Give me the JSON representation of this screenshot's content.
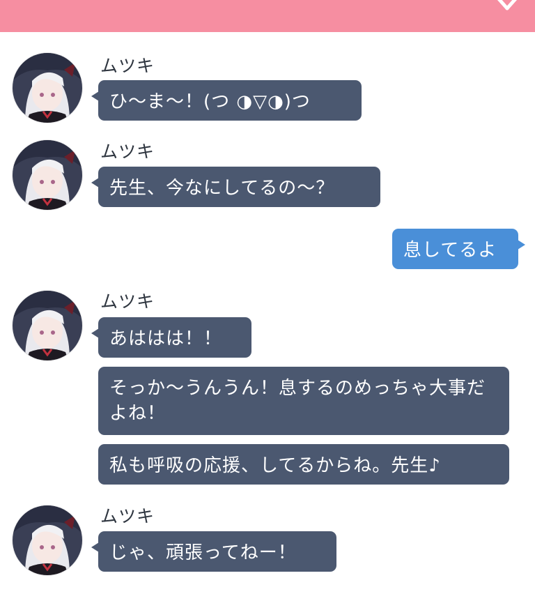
{
  "window": {
    "header_color": "#f68ea1"
  },
  "contact": {
    "name": "ムツキ",
    "avatar_icon": "mutsuki-avatar"
  },
  "messages": [
    {
      "from": "ムツキ",
      "text": "ひ〜ま〜！(つ ◑▽◑)つ"
    },
    {
      "from": "ムツキ",
      "text": "先生、今なにしてるの〜？"
    },
    {
      "from": "me",
      "text": "息してるよ"
    },
    {
      "from": "ムツキ",
      "text": "あははは！！"
    },
    {
      "from": "ムツキ",
      "text": "そっか〜うんうん！息するのめっちゃ大事だよね！"
    },
    {
      "from": "ムツキ",
      "text": "私も呼吸の応援、してるからね。先生♪"
    },
    {
      "from": "ムツキ",
      "text": "じゃ、頑張ってねー！"
    }
  ],
  "colors": {
    "incoming_bubble": "#4b5870",
    "outgoing_bubble": "#4a8fd8"
  }
}
